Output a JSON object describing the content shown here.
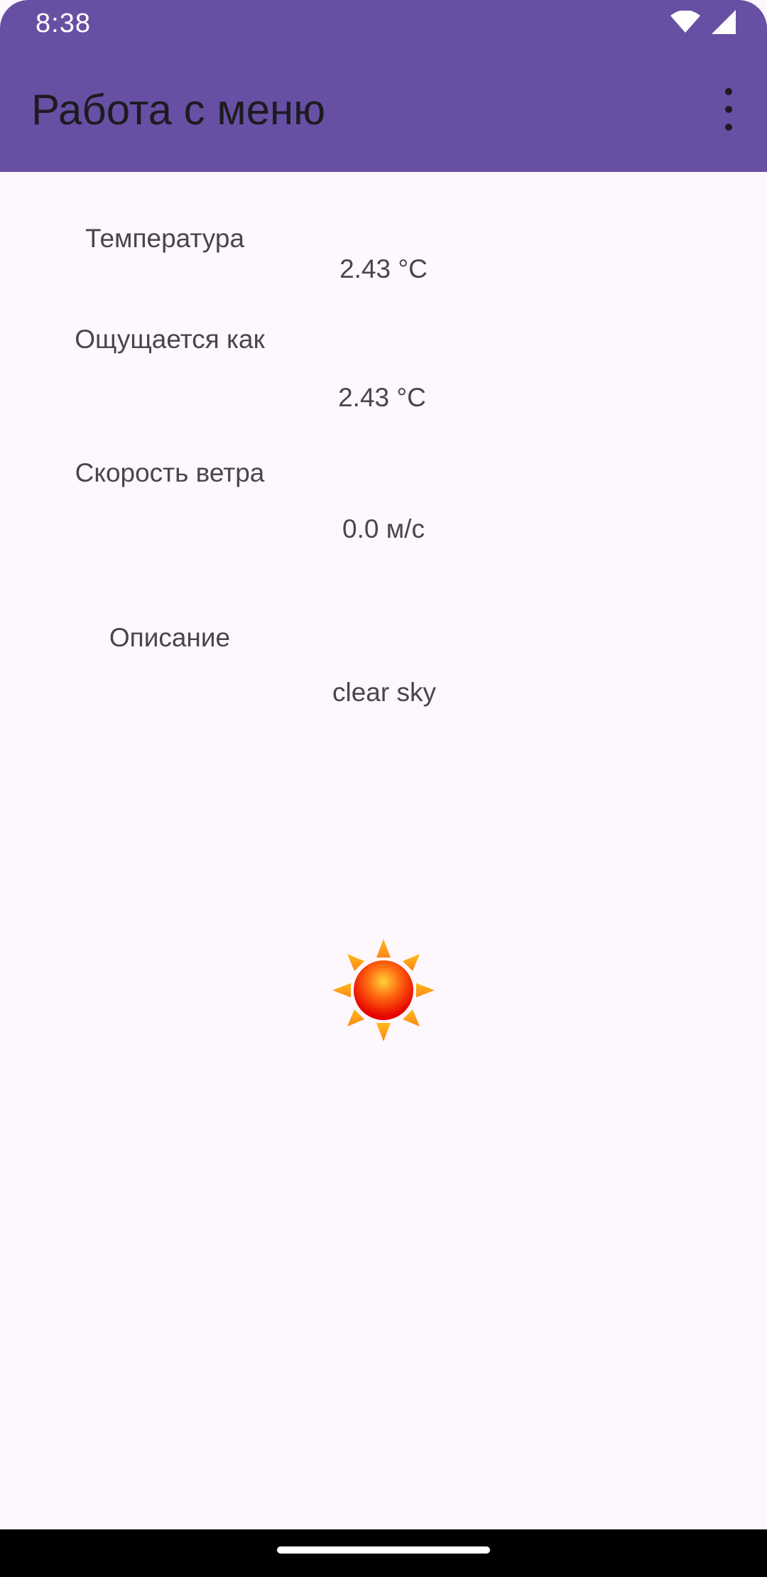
{
  "status_bar": {
    "time": "8:38",
    "icons": [
      "wifi-icon",
      "cellular-signal-icon"
    ]
  },
  "app_bar": {
    "title": "Работа с меню",
    "overflow_icon": "more-vert-icon"
  },
  "weather": {
    "temperature": {
      "label": "Температура",
      "value": "2.43 °C"
    },
    "feels_like": {
      "label": "Ощущается как",
      "value": "2.43 °C"
    },
    "wind_speed": {
      "label": "Скорость ветра",
      "value": "0.0 м/с"
    },
    "description": {
      "label": "Описание",
      "value": "clear sky"
    },
    "icon": "sun-icon"
  },
  "colors": {
    "primary": "#6750A4",
    "background": "#FDF7FE",
    "on_surface": "#1D1B20",
    "text_secondary": "#49454F"
  }
}
